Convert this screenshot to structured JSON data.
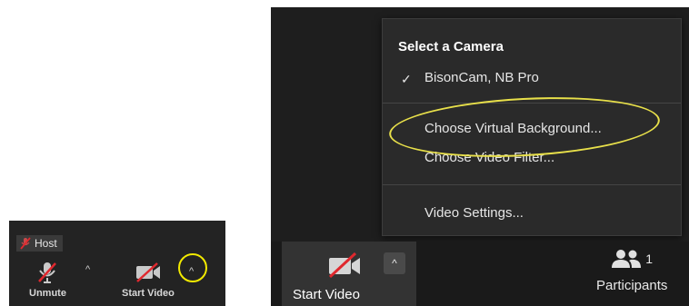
{
  "small_toolbar": {
    "host_label": "Host",
    "unmute_label": "Unmute",
    "start_video_label": "Start Video",
    "chevron": "^"
  },
  "camera_menu": {
    "title": "Select a Camera",
    "check_glyph": "✓",
    "camera_name": "BisonCam, NB Pro",
    "virtual_background": "Choose Virtual Background...",
    "video_filter": "Choose Video Filter...",
    "video_settings": "Video Settings..."
  },
  "big_toolbar": {
    "start_video_label": "Start Video",
    "chevron": "^",
    "participants_label": "Participants",
    "participants_count": "1"
  },
  "colors": {
    "highlight_yellow": "#f2ea00",
    "mute_red": "#e0282e",
    "panel_bg": "#1e1e1e",
    "menu_bg": "#2a2a2a"
  }
}
